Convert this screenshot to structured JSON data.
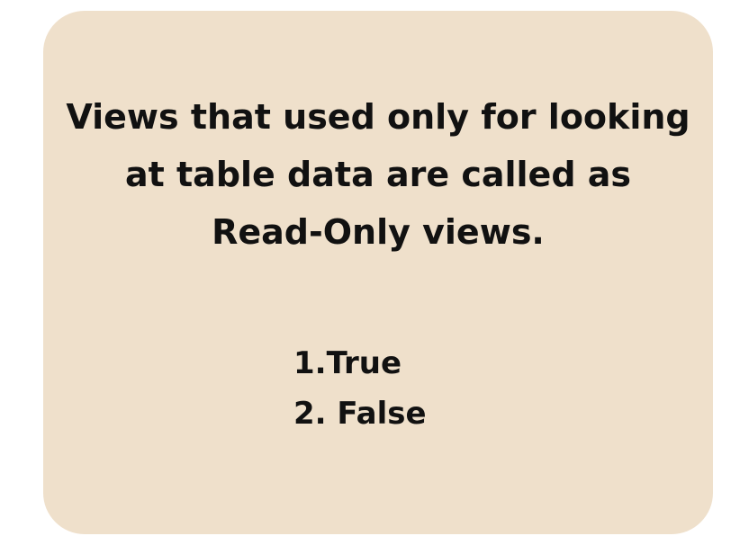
{
  "card": {
    "background_color": "#efe0cb",
    "question_lines": [
      "Views that used only for looking",
      "at table data are called as",
      "Read-Only views."
    ],
    "options": [
      "1.True",
      "2. False"
    ]
  }
}
